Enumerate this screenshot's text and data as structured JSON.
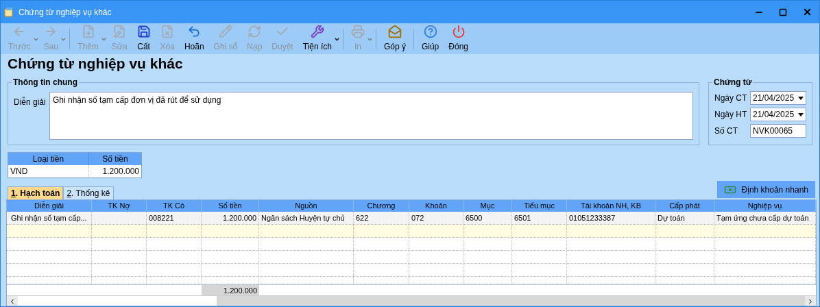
{
  "window": {
    "title": "Chứng từ nghiệp vụ khác"
  },
  "toolbar": [
    [
      {
        "label": "Trước",
        "disabled": true,
        "dropdown": true
      },
      {
        "label": "Sau",
        "disabled": true,
        "dropdown": true
      }
    ],
    [
      {
        "label": "Thêm",
        "disabled": true,
        "dropdown": true
      },
      {
        "label": "Sửa",
        "disabled": true,
        "dropdown": false
      },
      {
        "label": "Cất",
        "disabled": false,
        "dropdown": false
      },
      {
        "label": "Xóa",
        "disabled": true,
        "dropdown": false
      },
      {
        "label": "Hoãn",
        "disabled": false,
        "dropdown": false
      },
      {
        "label": "Ghi sổ",
        "disabled": true,
        "dropdown": false
      },
      {
        "label": "Nạp",
        "disabled": true,
        "dropdown": false
      },
      {
        "label": "Duyệt",
        "disabled": true,
        "dropdown": false
      },
      {
        "label": "Tiện ích",
        "disabled": false,
        "dropdown": true
      }
    ],
    [
      {
        "label": "In",
        "disabled": true,
        "dropdown": true
      }
    ],
    [
      {
        "label": "Góp ý",
        "disabled": false,
        "dropdown": false
      }
    ],
    [
      {
        "label": "Giúp",
        "disabled": false,
        "dropdown": false
      },
      {
        "label": "Đóng",
        "disabled": false,
        "dropdown": false
      }
    ]
  ],
  "heading": "Chứng từ nghiệp vụ khác",
  "general": {
    "title": "Thông tin chung",
    "label": "Diễn giải",
    "value": "Ghi nhận số tạm cấp đơn vị đã rút để sử dụng"
  },
  "voucher": {
    "title": "Chứng từ",
    "fields": [
      {
        "label": "Ngày CT",
        "value": "21/04/2025",
        "kind": "date"
      },
      {
        "label": "Ngày HT",
        "value": "21/04/2025",
        "kind": "date"
      },
      {
        "label": "Số CT",
        "value": "NVK00065",
        "kind": "text"
      }
    ]
  },
  "currency_table": {
    "columns": [
      "Loại tiền",
      "Số tiền"
    ],
    "rows": [
      [
        "VND",
        "1.200.000"
      ]
    ]
  },
  "tabs": [
    {
      "label": "1. Hạch toán",
      "selected": true
    },
    {
      "label": "2. Thống kê",
      "selected": false
    }
  ],
  "quick_button": "Định khoản nhanh",
  "grid": {
    "columns": [
      "Diễn giải",
      "TK Nợ",
      "TK Có",
      "Số tiền",
      "Nguồn",
      "Chương",
      "Khoản",
      "Mục",
      "Tiểu mục",
      "Tài khoản NH, KB",
      "Cấp phát",
      "Nghiệp vụ"
    ],
    "rows": [
      [
        "Ghi nhận số tạm cấp...",
        "",
        "008221",
        "1.200.000",
        "Ngân sách Huyện tự chủ",
        "622",
        "072",
        "6500",
        "6501",
        "01051233387",
        "Dự toán",
        "Tạm ứng chưa cấp dự toán"
      ]
    ],
    "total": "1.200.000"
  }
}
